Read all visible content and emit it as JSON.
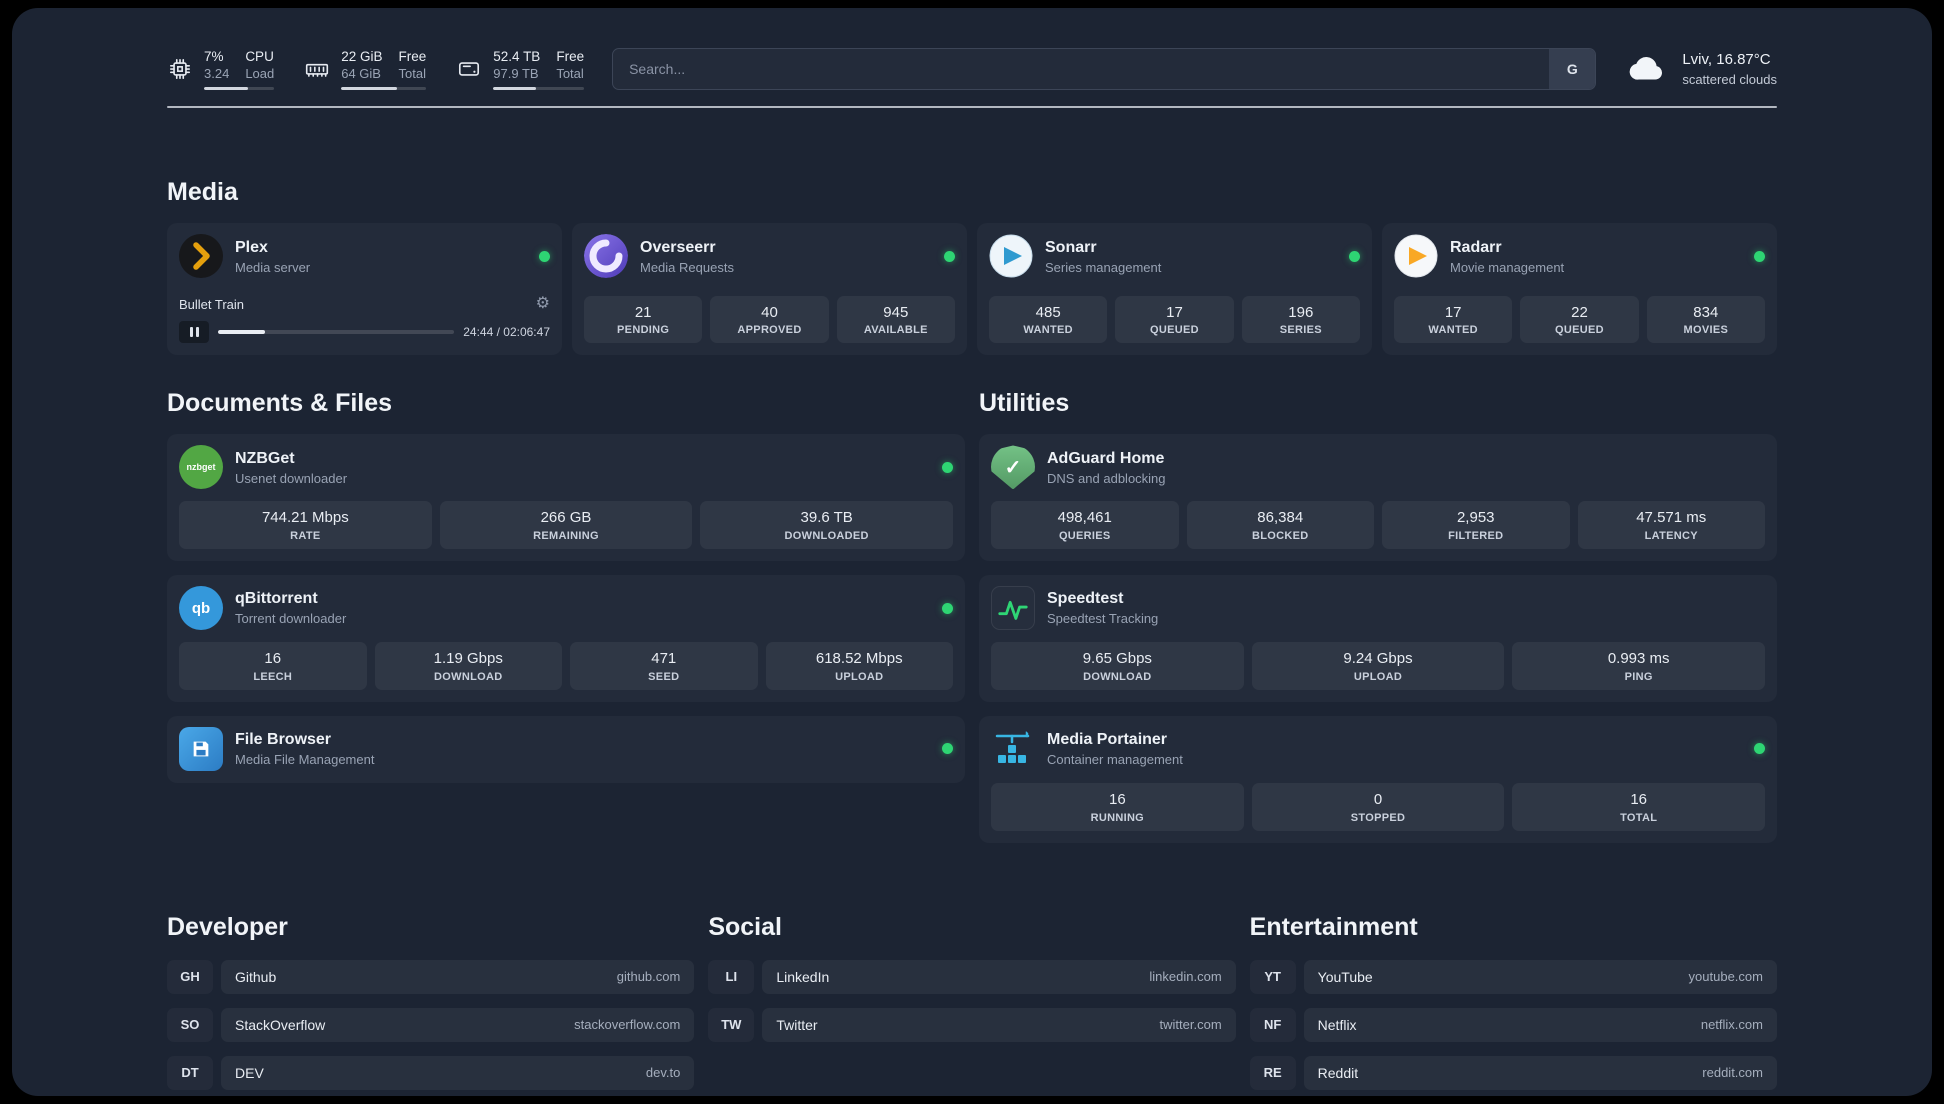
{
  "topbar": {
    "cpu": {
      "top_value": "7%",
      "bottom_value": "3.24",
      "top_label": "CPU",
      "bottom_label": "Load",
      "progress_pct": 62
    },
    "ram": {
      "top_value": "22 GiB",
      "bottom_value": "64 GiB",
      "top_label": "Free",
      "bottom_label": "Total",
      "progress_pct": 66
    },
    "disk": {
      "top_value": "52.4 TB",
      "bottom_value": "97.9 TB",
      "top_label": "Free",
      "bottom_label": "Total",
      "progress_pct": 47
    },
    "search": {
      "placeholder": "Search...",
      "provider_button": "G"
    },
    "weather": {
      "location_temp": "Lviv, 16.87°C",
      "condition": "scattered clouds"
    }
  },
  "sections": {
    "media": "Media",
    "documents": "Documents & Files",
    "utilities": "Utilities",
    "developer": "Developer",
    "social": "Social",
    "entertainment": "Entertainment"
  },
  "services": {
    "plex": {
      "name": "Plex",
      "subtitle": "Media server",
      "player": {
        "track": "Bullet Train",
        "time": "24:44 / 02:06:47",
        "progress_pct": 20
      }
    },
    "overseerr": {
      "name": "Overseerr",
      "subtitle": "Media Requests",
      "stats": [
        {
          "value": "21",
          "label": "PENDING"
        },
        {
          "value": "40",
          "label": "APPROVED"
        },
        {
          "value": "945",
          "label": "AVAILABLE"
        }
      ]
    },
    "sonarr": {
      "name": "Sonarr",
      "subtitle": "Series management",
      "stats": [
        {
          "value": "485",
          "label": "WANTED"
        },
        {
          "value": "17",
          "label": "QUEUED"
        },
        {
          "value": "196",
          "label": "SERIES"
        }
      ]
    },
    "radarr": {
      "name": "Radarr",
      "subtitle": "Movie management",
      "stats": [
        {
          "value": "17",
          "label": "WANTED"
        },
        {
          "value": "22",
          "label": "QUEUED"
        },
        {
          "value": "834",
          "label": "MOVIES"
        }
      ]
    },
    "nzbget": {
      "name": "NZBGet",
      "subtitle": "Usenet downloader",
      "stats": [
        {
          "value": "744.21 Mbps",
          "label": "RATE"
        },
        {
          "value": "266 GB",
          "label": "REMAINING"
        },
        {
          "value": "39.6 TB",
          "label": "DOWNLOADED"
        }
      ]
    },
    "qbittorrent": {
      "name": "qBittorrent",
      "subtitle": "Torrent downloader",
      "stats": [
        {
          "value": "16",
          "label": "LEECH"
        },
        {
          "value": "1.19 Gbps",
          "label": "DOWNLOAD"
        },
        {
          "value": "471",
          "label": "SEED"
        },
        {
          "value": "618.52 Mbps",
          "label": "UPLOAD"
        }
      ]
    },
    "filebrowser": {
      "name": "File Browser",
      "subtitle": "Media File Management"
    },
    "adguard": {
      "name": "AdGuard Home",
      "subtitle": "DNS and adblocking",
      "stats": [
        {
          "value": "498,461",
          "label": "QUERIES"
        },
        {
          "value": "86,384",
          "label": "BLOCKED"
        },
        {
          "value": "2,953",
          "label": "FILTERED"
        },
        {
          "value": "47.571 ms",
          "label": "LATENCY"
        }
      ]
    },
    "speedtest": {
      "name": "Speedtest",
      "subtitle": "Speedtest Tracking",
      "stats": [
        {
          "value": "9.65 Gbps",
          "label": "DOWNLOAD"
        },
        {
          "value": "9.24 Gbps",
          "label": "UPLOAD"
        },
        {
          "value": "0.993 ms",
          "label": "PING"
        }
      ]
    },
    "portainer": {
      "name": "Media Portainer",
      "subtitle": "Container management",
      "stats": [
        {
          "value": "16",
          "label": "RUNNING"
        },
        {
          "value": "0",
          "label": "STOPPED"
        },
        {
          "value": "16",
          "label": "TOTAL"
        }
      ]
    }
  },
  "bookmarks": {
    "developer": [
      {
        "abbr": "GH",
        "name": "Github",
        "url": "github.com"
      },
      {
        "abbr": "SO",
        "name": "StackOverflow",
        "url": "stackoverflow.com"
      },
      {
        "abbr": "DT",
        "name": "DEV",
        "url": "dev.to"
      }
    ],
    "social": [
      {
        "abbr": "LI",
        "name": "LinkedIn",
        "url": "linkedin.com"
      },
      {
        "abbr": "TW",
        "name": "Twitter",
        "url": "twitter.com"
      }
    ],
    "entertainment": [
      {
        "abbr": "YT",
        "name": "YouTube",
        "url": "youtube.com"
      },
      {
        "abbr": "NF",
        "name": "Netflix",
        "url": "netflix.com"
      },
      {
        "abbr": "RE",
        "name": "Reddit",
        "url": "reddit.com"
      }
    ]
  },
  "icons": {
    "gear_glyph": "⚙",
    "adguard_check": "✓",
    "qbittorrent_text": "qb",
    "nzbget_text": "nzbget"
  },
  "colors": {
    "status_green": "#2ed573",
    "plex_amber": "#e5a00d",
    "panel_bg": "#1c2433"
  }
}
